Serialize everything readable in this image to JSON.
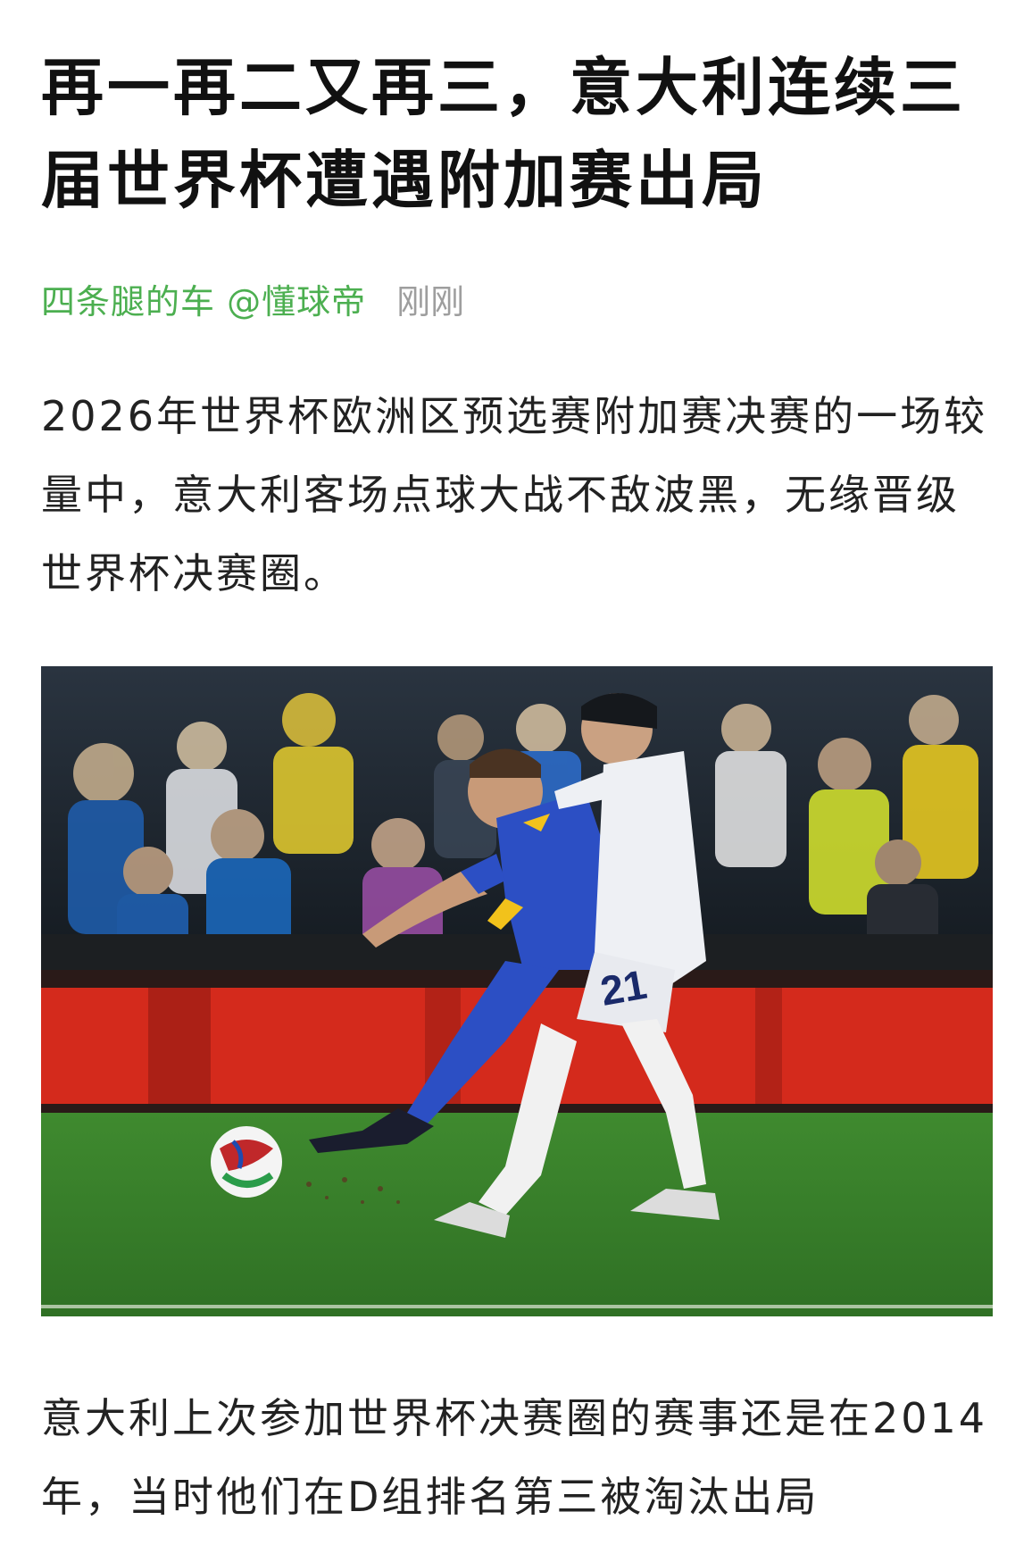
{
  "article": {
    "title": "再一再二又再三，意大利连续三届世界杯遭遇附加赛出局",
    "author": "四条腿的车 @懂球帝",
    "time": "刚刚",
    "paragraphs": [
      "2026年世界杯欧洲区预选赛附加赛决赛的一场较量中，意大利客场点球大战不敌波黑，无缘晋级世界杯决赛圈。",
      "意大利上次参加世界杯决赛圈的赛事还是在2014年，当时他们在D组排名第三被淘汰出局"
    ],
    "photo": {
      "jersey_number": "21"
    }
  },
  "colors": {
    "author": "#4caf50",
    "time": "#9e9e9e",
    "pitch": "#3f8a2f",
    "ad_board": "#d42a1c",
    "blue_kit": "#2c4fc4",
    "yellow_trim": "#f2c21b",
    "white_kit": "#eef0f4"
  }
}
